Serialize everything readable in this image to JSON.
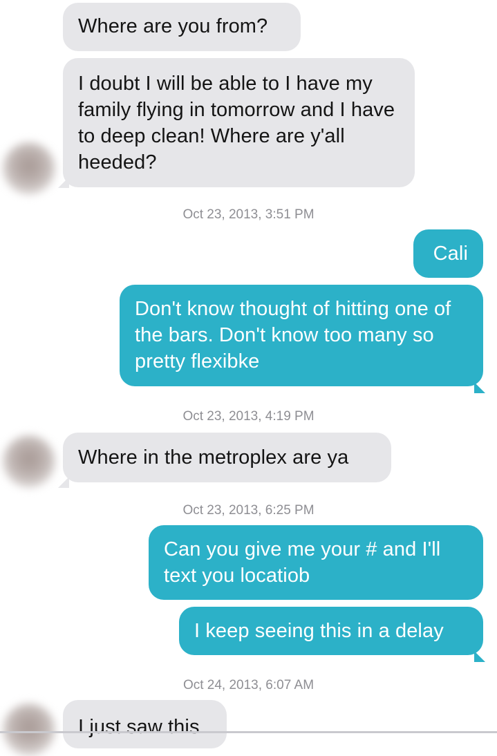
{
  "colors": {
    "incoming_bubble": "#e6e6e9",
    "outgoing_bubble": "#2cb1c8",
    "timestamp_text": "#8e8e93"
  },
  "messages": [
    {
      "direction": "incoming",
      "text": "Where are you from?"
    },
    {
      "direction": "incoming",
      "text": "I doubt I will be able to I have my family flying in tomorrow and I have to deep clean! Where are y'all heeded?"
    },
    {
      "direction": "timestamp",
      "text": "Oct 23, 2013, 3:51 PM"
    },
    {
      "direction": "outgoing",
      "text": "Cali"
    },
    {
      "direction": "outgoing",
      "text": "Don't know thought of hitting one of the bars. Don't know too many so pretty flexibke"
    },
    {
      "direction": "timestamp",
      "text": "Oct 23, 2013, 4:19 PM"
    },
    {
      "direction": "incoming",
      "text": "Where in the metroplex are ya"
    },
    {
      "direction": "timestamp",
      "text": "Oct 23, 2013, 6:25 PM"
    },
    {
      "direction": "outgoing",
      "text": "Can you give me your # and I'll text you locatiob"
    },
    {
      "direction": "outgoing",
      "text": "I keep seeing this in a delay"
    },
    {
      "direction": "timestamp",
      "text": "Oct 24, 2013, 6:07 AM"
    },
    {
      "direction": "incoming",
      "text": "I just saw this"
    }
  ]
}
